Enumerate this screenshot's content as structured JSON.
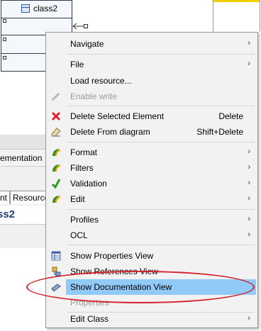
{
  "diagram": {
    "class_name": "class2"
  },
  "background_view": {
    "tab_partial": "ementation",
    "subtab_1": "nt",
    "subtab_2": "Resource",
    "title_partial": "ss2"
  },
  "context_menu": {
    "items": [
      {
        "label": "Navigate",
        "submenu": "›"
      },
      {
        "label": "File",
        "submenu": "›"
      },
      {
        "label": "Load resource..."
      },
      {
        "label": "Enable write"
      },
      {
        "label": "Delete Selected Element",
        "shortcut": "Delete"
      },
      {
        "label": "Delete From diagram",
        "shortcut": "Shift+Delete"
      },
      {
        "label": "Format",
        "submenu": "›"
      },
      {
        "label": "Filters",
        "submenu": "›"
      },
      {
        "label": "Validation",
        "submenu": "›"
      },
      {
        "label": "Edit",
        "submenu": "›"
      },
      {
        "label": "Profiles",
        "submenu": "›"
      },
      {
        "label": "OCL",
        "submenu": "›"
      },
      {
        "label": "Show Properties View"
      },
      {
        "label": "Show References View"
      },
      {
        "label": "Show Documentation View"
      },
      {
        "label": "Properties"
      },
      {
        "label": "Edit Class",
        "submenu": "›"
      }
    ]
  },
  "colors": {
    "highlight": "#91c9f7",
    "annotation_circle": "#d4202a"
  }
}
